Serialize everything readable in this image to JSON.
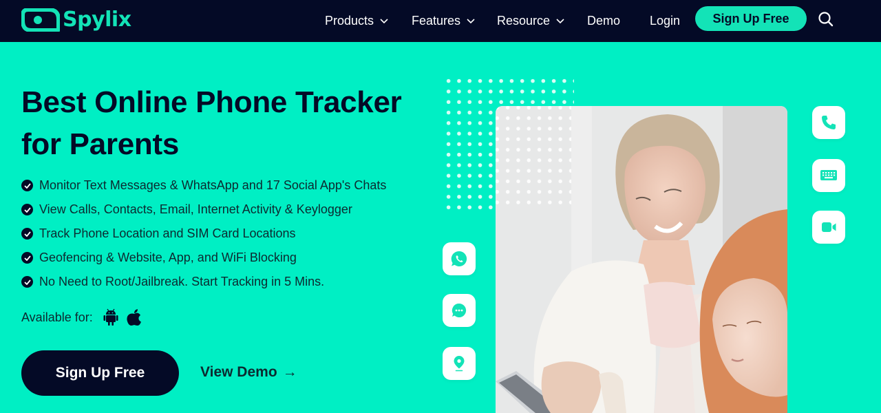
{
  "brand": {
    "name": "Spylix",
    "accent": "#13e3b7",
    "dark": "#040a26",
    "hero_bg": "#00efc4"
  },
  "nav": {
    "items": [
      {
        "label": "Products",
        "has_dropdown": true
      },
      {
        "label": "Features",
        "has_dropdown": true
      },
      {
        "label": "Resource",
        "has_dropdown": true
      },
      {
        "label": "Demo",
        "has_dropdown": false
      },
      {
        "label": "Login",
        "has_dropdown": false
      }
    ],
    "signup_label": "Sign Up Free",
    "search_icon": "search-icon"
  },
  "hero": {
    "title_line1": "Best Online Phone Tracker",
    "title_line2": "for Parents",
    "features": [
      "Monitor Text Messages & WhatsApp and 17 Social App's Chats",
      "View Calls, Contacts, Email, Internet Activity & Keylogger",
      "Track Phone Location and SIM Card Locations",
      "Geofencing & Website, App, and WiFi Blocking",
      "No Need to Root/Jailbreak. Start Tracking in 5 Mins."
    ],
    "available_label": "Available for:",
    "platforms": [
      "android-icon",
      "apple-icon"
    ],
    "cta_primary": "Sign Up Free",
    "cta_secondary": "View Demo",
    "cta_secondary_arrow": "→"
  },
  "floating_icons": {
    "left": [
      "whatsapp-icon",
      "chat-bubble-icon",
      "location-pin-icon"
    ],
    "right": [
      "phone-icon",
      "keyboard-icon",
      "video-camera-icon"
    ]
  },
  "image": {
    "description": "Mother and daughter looking at a smartphone"
  }
}
